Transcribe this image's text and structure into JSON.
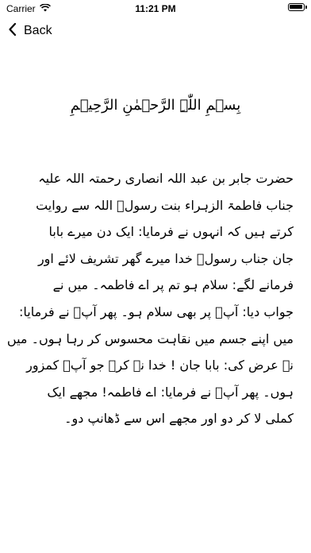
{
  "status_bar": {
    "carrier": "Carrier",
    "time": "11:21 PM"
  },
  "nav": {
    "back_label": "Back"
  },
  "content": {
    "bismillah": "بِسۡمِ اللّٰہِ الرَّحۡمٰنِ الرَّحِیۡمِ",
    "lines": [
      "حضرت جابر بن عبد اللہ انصاری رحمتہ اللہ علیہ",
      "جناب فاطمۃ الزہراء بنت رسولؐ اللہ سے روایت",
      "کرتے ہیں کہ انہوں نے فرمایا: ایک دن میرے بابا",
      "جان جناب رسولؐ خدا میرے گھر تشریف لائے اور",
      "فرمانے لگے: سلام ہو تم پر اے فاطمہ۔ میں نے",
      "جواب دیا: آپؐ پر بھی سلام ہو۔ پھر آپؐ نے فرمایا:",
      "میں اپنے جسم میں نقاہت محسوس کر رہا ہوں۔ میں",
      "نے عرض کی: بابا جان ! خدا نہ کرے جو آپؐ کمزور",
      "ہوں۔ پھر آپؐ نے فرمایا: اے فاطمہ! مجھے ایک",
      "کملی لا کر دو اور مجھے اس سے ڈھانپ دو۔"
    ]
  }
}
